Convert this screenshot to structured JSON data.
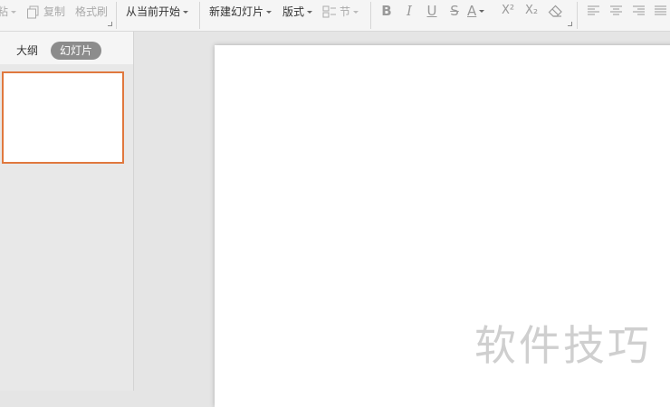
{
  "toolbar": {
    "paste_label": "粘",
    "copy_label": "复制",
    "format_painter_label": "格式刷",
    "play_from_current_label": "从当前开始",
    "new_slide_label": "新建幻灯片",
    "layout_label": "版式",
    "section_label": "节",
    "bold_glyph": "B",
    "italic_glyph": "I",
    "underline_glyph": "U",
    "strike_glyph": "S",
    "font_color_glyph": "A",
    "superscript_glyph": "X²",
    "subscript_glyph": "X₂"
  },
  "left_panel": {
    "tab_outline": "大纲",
    "tab_slides": "幻灯片"
  },
  "watermark": "软件技巧",
  "colors": {
    "toolbar_bg": "#f5f5f5",
    "panel_bg": "#e8e8e8",
    "active_tab_bg": "#8c8c8c",
    "selected_thumb_border": "#e0783e",
    "slide_bg": "#ffffff"
  }
}
